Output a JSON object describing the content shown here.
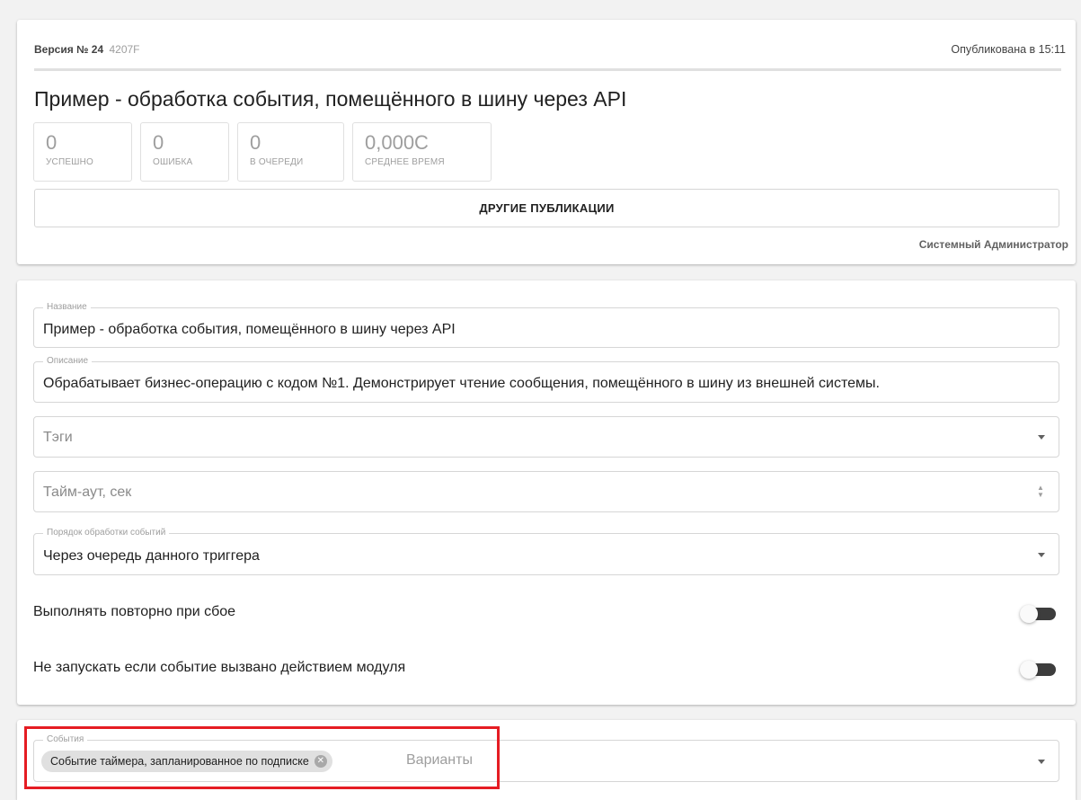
{
  "publication": {
    "version_label": "Версия № 24",
    "version_hash": "4207F",
    "published_text": "Опубликована в 15:11",
    "title": "Пример - обработка события, помещённого в шину через API",
    "stats": [
      {
        "value": "0",
        "label": "УСПЕШНО"
      },
      {
        "value": "0",
        "label": "ОШИБКА"
      },
      {
        "value": "0",
        "label": "В ОЧЕРЕДИ"
      },
      {
        "value": "0,000С",
        "label": "СРЕДНЕЕ ВРЕМЯ"
      }
    ],
    "other_publications_button": "ДРУГИЕ ПУБЛИКАЦИИ",
    "author": "Системный Администратор"
  },
  "form": {
    "name": {
      "label": "Название",
      "value": "Пример - обработка события, помещённого в шину через API"
    },
    "description": {
      "label": "Описание",
      "value": "Обрабатывает бизнес-операцию с кодом №1. Демонстрирует чтение сообщения, помещённого в шину из внешней системы."
    },
    "tags": {
      "placeholder": "Тэги"
    },
    "timeout": {
      "placeholder": "Тайм-аут, сек"
    },
    "order": {
      "label": "Порядок обработки событий",
      "value": "Через очередь данного триггера"
    },
    "retry_toggle": {
      "label": "Выполнять повторно при сбое",
      "on": false
    },
    "module_toggle": {
      "label": "Не запускать если событие вызвано действием модуля",
      "on": false
    }
  },
  "events": {
    "label": "События",
    "chips": [
      "Событие таймера, запланированное по подписке"
    ],
    "placeholder": "Варианты"
  },
  "colors": {
    "highlight": "#e51c23",
    "toggle_track": "#3d3d3d",
    "chip_bg": "#e0e0e0"
  }
}
